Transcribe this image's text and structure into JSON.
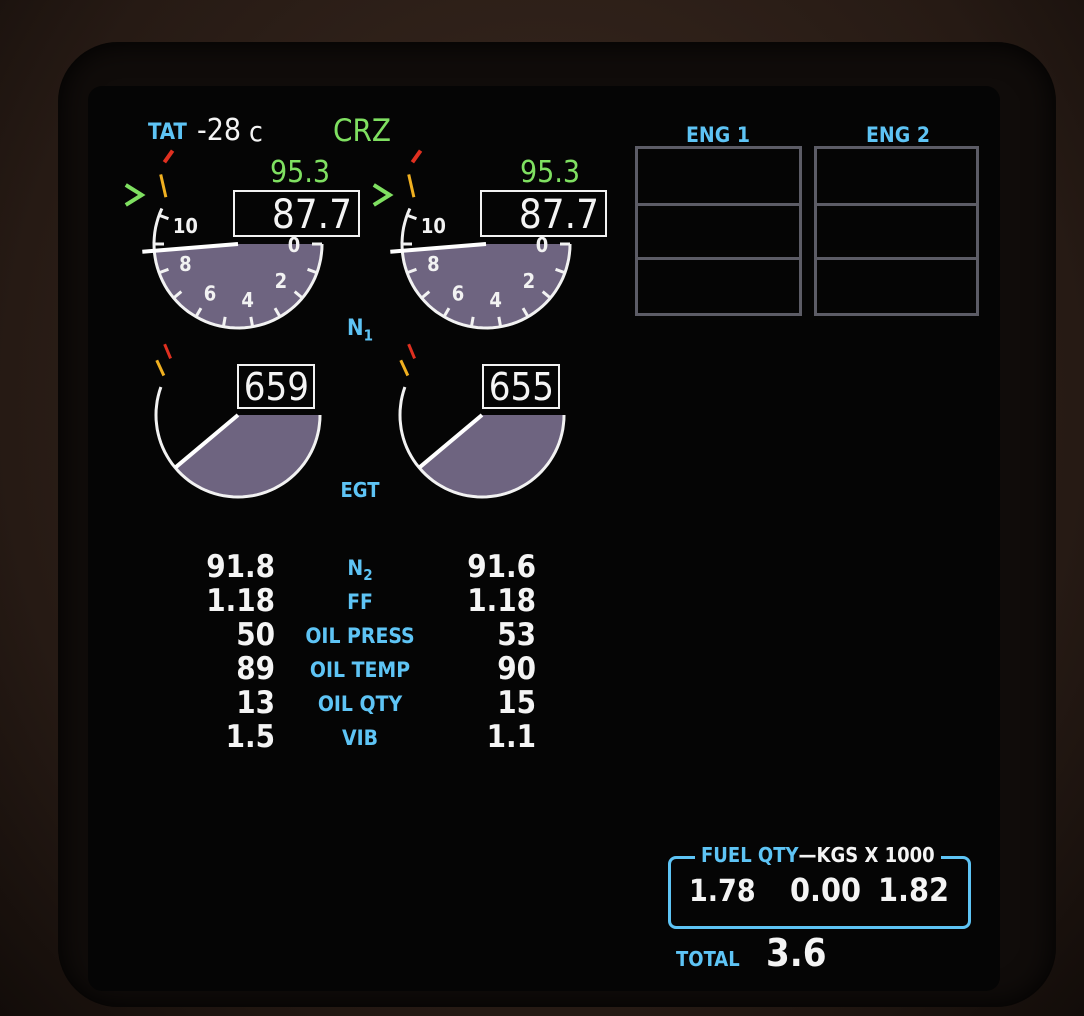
{
  "header": {
    "tat_label": "TAT",
    "tat_value": "-28",
    "tat_unit": "c",
    "mode": "CRZ"
  },
  "n1": {
    "label": "N",
    "label_sub": "1",
    "engines": [
      {
        "reference": "95.3",
        "value": "87.7",
        "value_num": 87.7
      },
      {
        "reference": "95.3",
        "value": "87.7",
        "value_num": 87.7
      }
    ],
    "scale_labels": [
      "10",
      "8",
      "6",
      "4",
      "2",
      "0"
    ]
  },
  "egt": {
    "label": "EGT",
    "engines": [
      {
        "value": "659"
      },
      {
        "value": "655"
      }
    ]
  },
  "secondary": {
    "rows": [
      {
        "label": "N",
        "label_sub": "2",
        "left": "91.8",
        "right": "91.6"
      },
      {
        "label": "FF",
        "left": "1.18",
        "right": "1.18"
      },
      {
        "label": "OIL PRESS",
        "left": "50",
        "right": "53"
      },
      {
        "label": "OIL TEMP",
        "left": "89",
        "right": "90"
      },
      {
        "label": "OIL QTY",
        "left": "13",
        "right": "15"
      },
      {
        "label": "VIB",
        "left": "1.5",
        "right": "1.1"
      }
    ]
  },
  "eng_panel": {
    "eng1_label": "ENG 1",
    "eng2_label": "ENG 2"
  },
  "fuel": {
    "title": "FUEL QTY",
    "dash": "—",
    "units": "KGS X 1000",
    "left": "1.78",
    "center": "0.00",
    "right": "1.82",
    "total_label": "TOTAL",
    "total": "3.6"
  },
  "colors": {
    "label_cyan": "#5ec4f5",
    "mode_green": "#7fe061",
    "gauge_fill": "#6e6480",
    "caution_amber": "#f0b020",
    "limit_red": "#e03020"
  }
}
